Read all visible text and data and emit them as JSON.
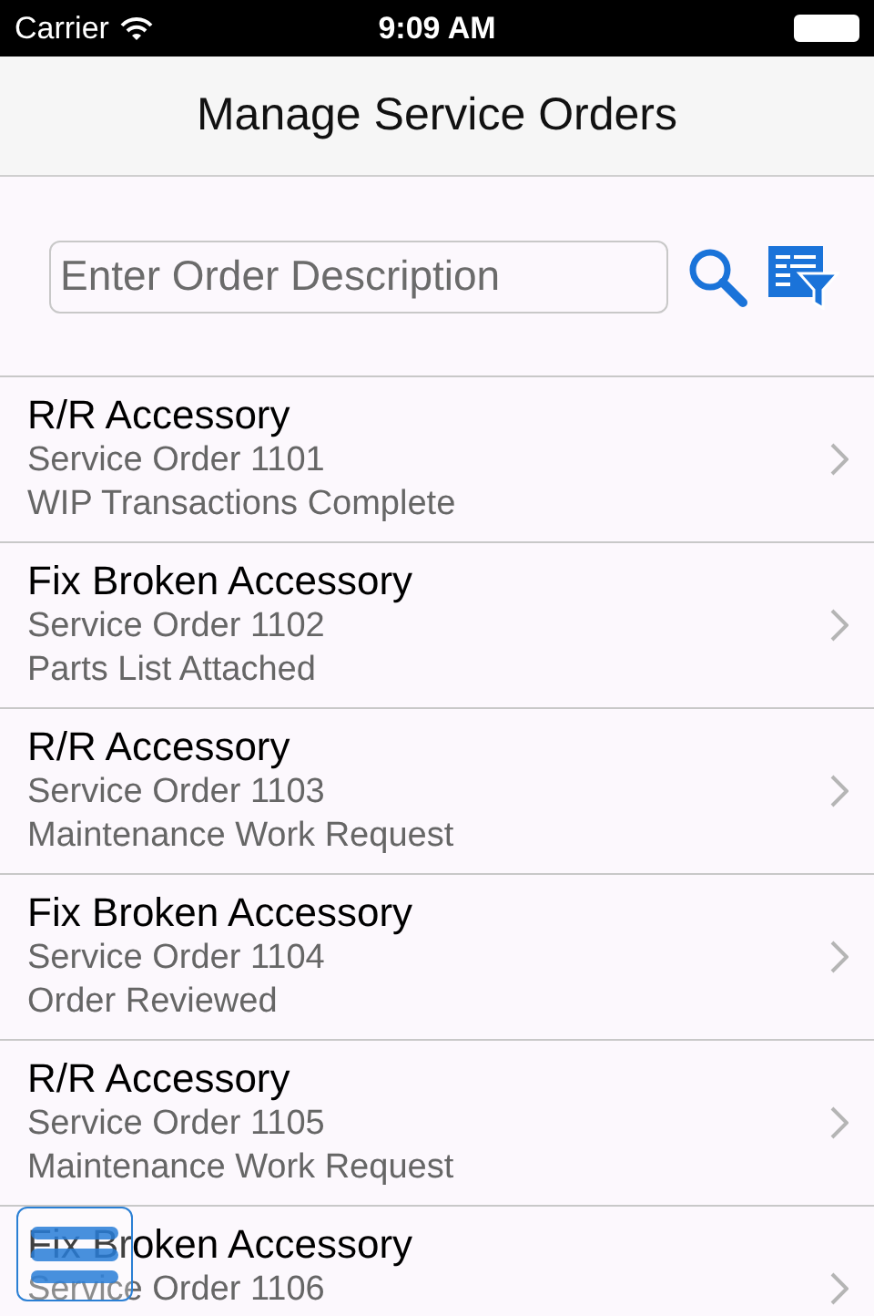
{
  "status_bar": {
    "carrier": "Carrier",
    "time": "9:09 AM"
  },
  "title": "Manage Service Orders",
  "search": {
    "placeholder": "Enter Order Description"
  },
  "orders": [
    {
      "title": "R/R Accessory",
      "order": "Service Order 1101",
      "status": "WIP Transactions Complete"
    },
    {
      "title": "Fix Broken Accessory",
      "order": "Service Order 1102",
      "status": "Parts List Attached"
    },
    {
      "title": "R/R Accessory",
      "order": "Service Order 1103",
      "status": "Maintenance Work Request"
    },
    {
      "title": "Fix Broken Accessory",
      "order": "Service Order 1104",
      "status": "Order Reviewed"
    },
    {
      "title": "R/R Accessory",
      "order": "Service Order 1105",
      "status": "Maintenance Work Request"
    },
    {
      "title": "Fix Broken Accessory",
      "order": "Service Order 1106"
    }
  ]
}
